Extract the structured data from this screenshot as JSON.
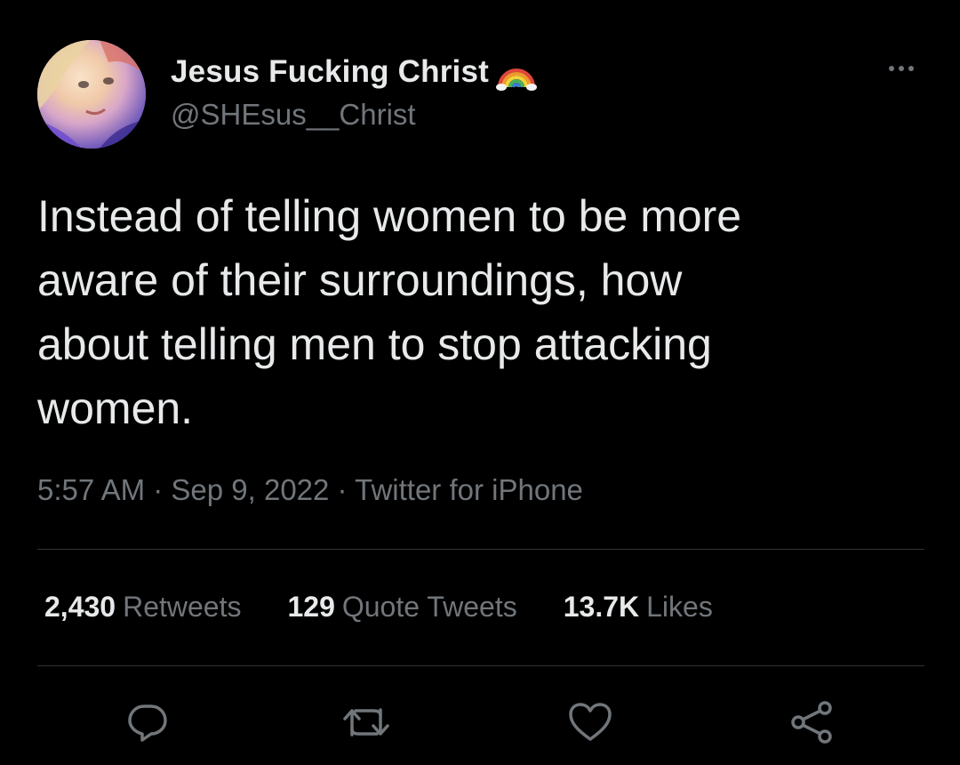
{
  "author": {
    "display_name": "Jesus Fucking Christ",
    "handle": "@SHEsus__Christ",
    "badge_icon": "rainbow-icon"
  },
  "tweet": {
    "text": "Instead of telling women to be more\naware of their surroundings, how\nabout telling men to stop attacking\nwomen.",
    "meta": "5:57 AM · Sep 9, 2022 · Twitter for iPhone"
  },
  "stats": {
    "retweets": {
      "count": "2,430",
      "label": "Retweets"
    },
    "quotes": {
      "count": "129",
      "label": "Quote Tweets"
    },
    "likes": {
      "count": "13.7K",
      "label": "Likes"
    }
  },
  "actions": {
    "icons": [
      "reply-icon",
      "retweet-icon",
      "like-icon",
      "share-icon"
    ],
    "icon_color": "#71767b"
  },
  "colors": {
    "background": "#000000",
    "primary_text": "#e7e9ea",
    "secondary_text": "#71767b",
    "divider": "#2f3336"
  }
}
